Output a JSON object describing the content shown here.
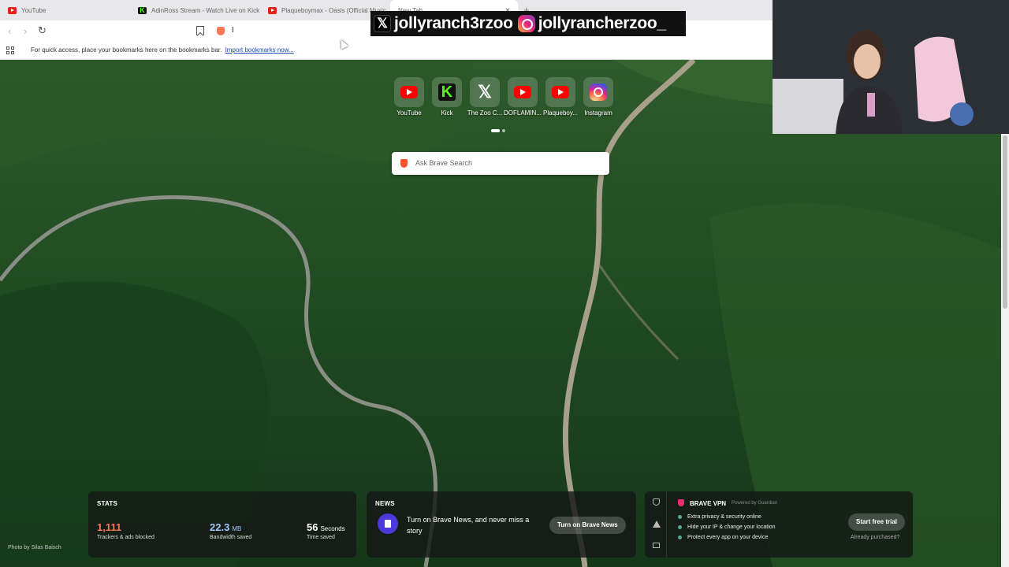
{
  "tabs": [
    {
      "title": "YouTube",
      "icon": "youtube-icon",
      "active": false
    },
    {
      "title": "AdinRoss Stream - Watch Live on Kick",
      "icon": "kick-icon",
      "active": false
    },
    {
      "title": "Plaqueboymax - Oasis (Official Music",
      "icon": "youtube-icon",
      "active": false
    },
    {
      "title": "New Tab",
      "icon": "",
      "active": true,
      "close": "×"
    }
  ],
  "toolbar": {
    "back": "‹",
    "forward": "›",
    "reload": "↻",
    "address_value": "I"
  },
  "bookmarks_bar": {
    "message": "For quick access, place your bookmarks here on the bookmarks bar.",
    "link": "Import bookmarks now..."
  },
  "overlay": {
    "x_handle": "jollyranch3rzoo",
    "instagram_handle": "jollyrancherzoo_"
  },
  "top_sites": [
    {
      "label": "YouTube",
      "icon": "youtube-icon"
    },
    {
      "label": "Kick",
      "icon": "kick-icon"
    },
    {
      "label": "The Zoo C...",
      "icon": "x-icon"
    },
    {
      "label": "DOFLAMIN...",
      "icon": "youtube-icon"
    },
    {
      "label": "Plaqueboy...",
      "icon": "youtube-icon"
    },
    {
      "label": "Instagram",
      "icon": "instagram-icon"
    }
  ],
  "search": {
    "placeholder": "Ask Brave Search"
  },
  "stats": {
    "title": "STATS",
    "trackers_value": "1,111",
    "trackers_label": "Trackers & ads blocked",
    "bandwidth_value": "22.3",
    "bandwidth_unit": "MB",
    "bandwidth_label": "Bandwidth saved",
    "time_value": "56",
    "time_unit": "Seconds",
    "time_label": "Time saved"
  },
  "news": {
    "title": "NEWS",
    "text": "Turn on Brave News, and never miss a story",
    "button": "Turn on Brave News"
  },
  "vpn": {
    "title": "BRAVE VPN",
    "powered_by": "Powered by Guardian",
    "features": [
      "Extra privacy & security online",
      "Hide your IP & change your location",
      "Protect every app on your device"
    ],
    "button": "Start free trial",
    "secondary": "Already purchased?"
  },
  "photo_credit": "Photo by Silas Baisch",
  "colors": {
    "trackers": "#ff7654",
    "bandwidth": "#a3c6ff",
    "accent": "#fb542b"
  }
}
